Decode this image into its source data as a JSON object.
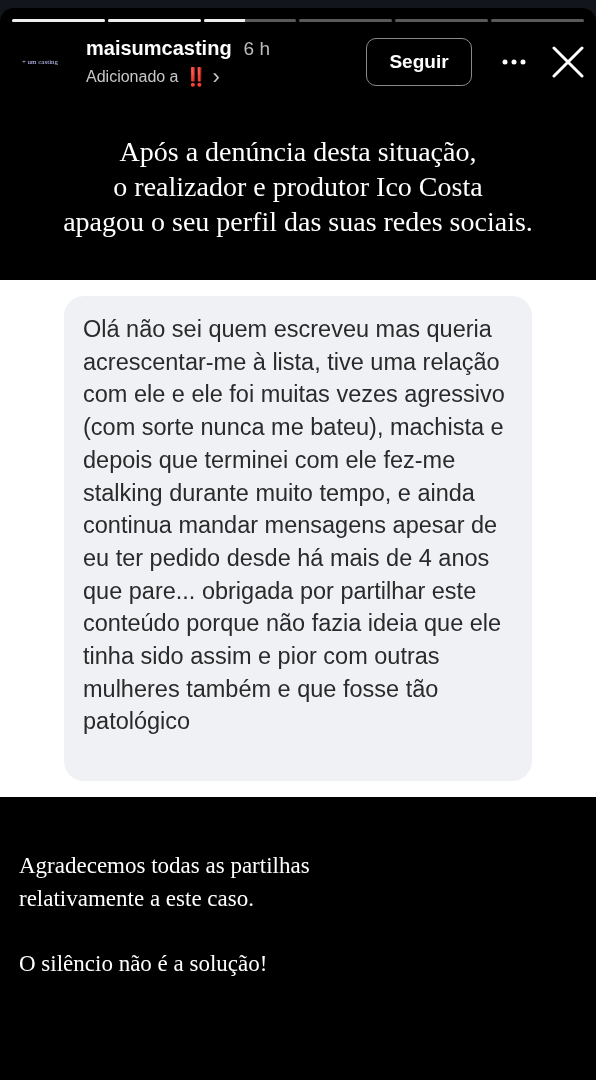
{
  "progress": [
    {
      "level": 1
    },
    {
      "level": 1
    },
    {
      "level": 0.45
    },
    {
      "level": 0
    },
    {
      "level": 0
    },
    {
      "level": 0
    }
  ],
  "header": {
    "avatar_text": "+ um casting",
    "username": "maisumcasting",
    "time": "6 h",
    "subtitle": "Adicionado a",
    "highlight_icon": "‼️",
    "chevron": "›",
    "follow_button": "Seguir"
  },
  "headline": "Após a denúncia desta situação,\no realizador e produtor Ico Costa\napagou o seu perfil das suas redes sociais.",
  "message": "Olá não sei quem escreveu mas queria acrescentar-me à lista, tive uma relação com ele e ele foi muitas vezes agressivo (com sorte nunca me bateu), machista e depois que terminei com ele fez-me stalking durante muito tempo, e ainda continua mandar mensagens apesar de eu ter pedido desde há mais de 4 anos que pare... obrigada por partilhar este conteúdo porque não fazia ideia que ele tinha sido assim e pior com outras mulheres também e que fosse tão patológico",
  "footer_paragraphs": [
    "Agradecemos todas as partilhas\nrelativamente a este caso.",
    "O silêncio não é a solução!"
  ]
}
